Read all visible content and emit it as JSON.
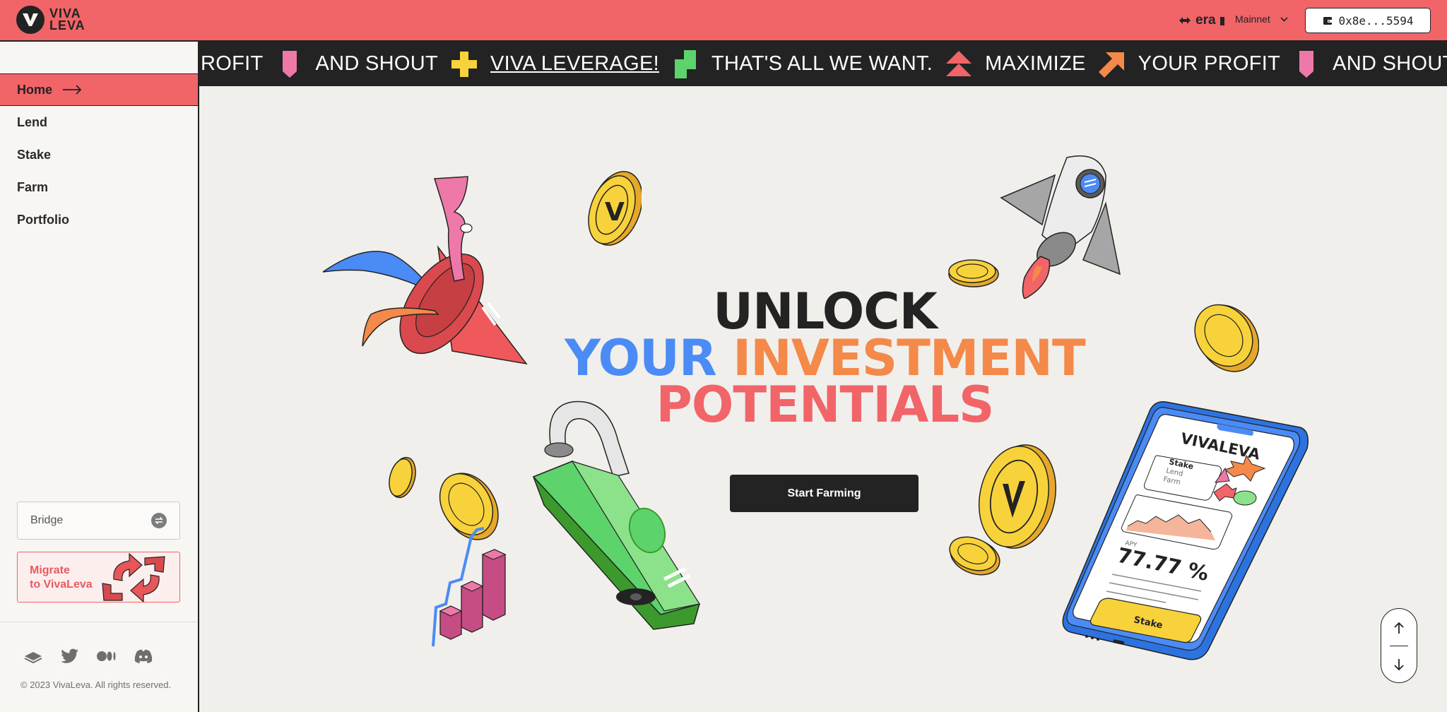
{
  "header": {
    "brand_line1": "VIVA",
    "brand_line2": "LEVA",
    "chain_name": "era",
    "network_label": "Mainnet",
    "wallet_address": "0x8e...5594",
    "accent_color": "#f16468"
  },
  "sidebar": {
    "items": [
      {
        "label": "Home",
        "active": true
      },
      {
        "label": "Lend",
        "active": false
      },
      {
        "label": "Stake",
        "active": false
      },
      {
        "label": "Farm",
        "active": false
      },
      {
        "label": "Portfolio",
        "active": false
      }
    ],
    "bridge_label": "Bridge",
    "migrate_line1": "Migrate",
    "migrate_line2": "to VivaLeva",
    "socials": [
      "book-icon",
      "twitter-icon",
      "medium-icon",
      "discord-icon"
    ],
    "copyright": "© 2023 VivaLeva. All rights reserved."
  },
  "ticker": {
    "segments": [
      "ROFIT",
      "AND SHOUT",
      "VIVA LEVERAGE!",
      "THAT'S ALL WE WANT.",
      "MAXIMIZE",
      "YOUR PROFIT",
      "AND SHOUT"
    ]
  },
  "hero": {
    "line1": "UNLOCK",
    "line2a": "YOUR",
    "line2b": "INVESTMENT",
    "line3": "POTENTIALS",
    "cta_label": "Start Farming",
    "phone_brand": "VIVALEVA",
    "phone_menu": [
      "Stake",
      "Lend",
      "Farm"
    ],
    "phone_apy_label": "APY",
    "phone_apy_value": "77.77 %",
    "phone_button": "Stake",
    "coin_letter": "V"
  }
}
